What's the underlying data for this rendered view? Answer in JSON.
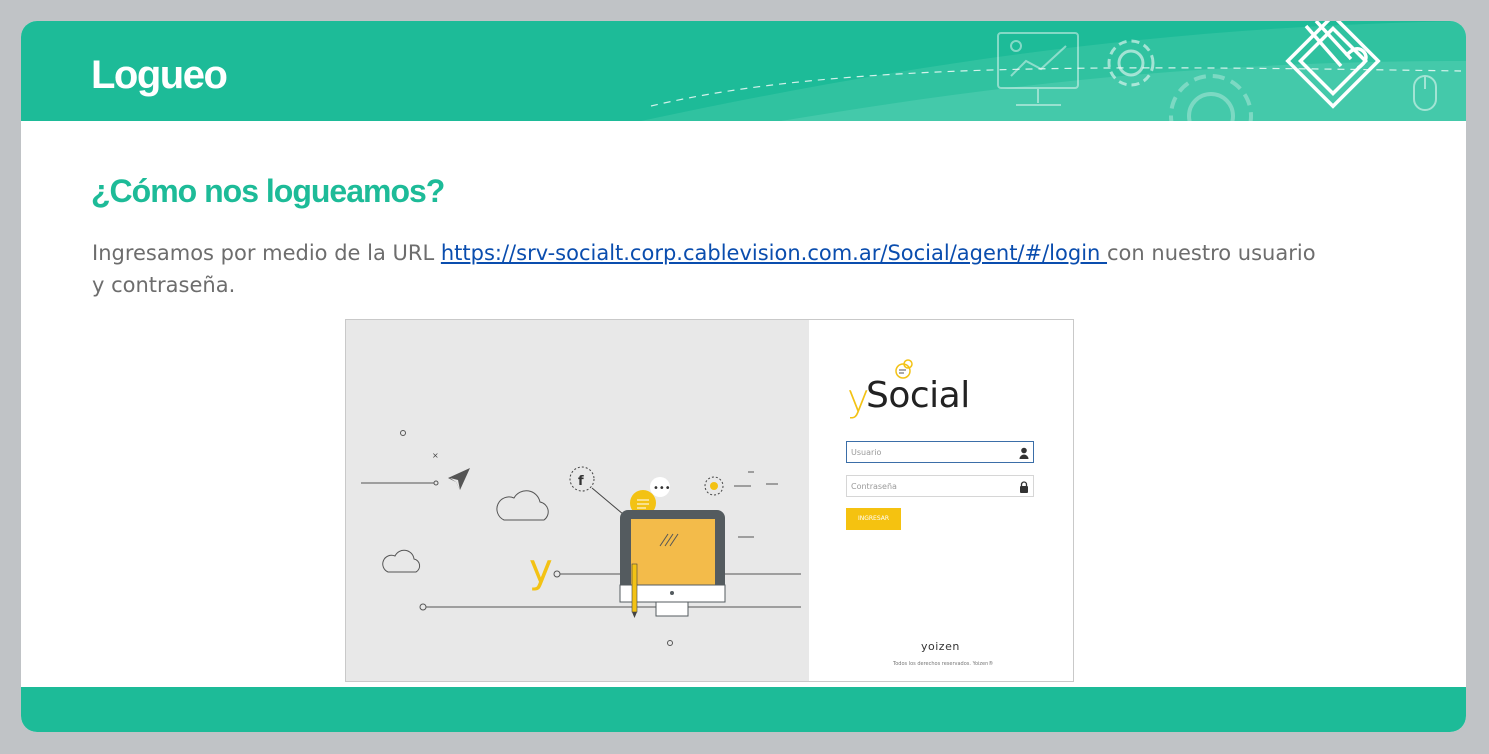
{
  "header": {
    "title": "Logueo"
  },
  "section": {
    "subtitle": "¿Cómo nos logueamos?",
    "text_before": "Ingresamos por medio de la URL ",
    "link": "https://srv-socialt.corp.cablevision.com.ar/Social/agent/#/login ",
    "text_after": "con nuestro usuario y contraseña."
  },
  "login_screenshot": {
    "logo_y": "y",
    "logo_text": "Social",
    "username_placeholder": "Usuario",
    "password_placeholder": "Contraseña",
    "login_button": "INGRESAR",
    "brand": "yoizen",
    "copyright": "Todos los derechos reservados. Yoizen®",
    "icons": [
      "user-icon",
      "lock-icon",
      "facebook-icon",
      "twitter-icon",
      "paper-plane-icon",
      "cloud-icon",
      "monitor-icon",
      "pencil-icon",
      "chat-bubble-icon"
    ]
  },
  "colors": {
    "brand_green": "#1dbb98",
    "link_blue": "#0a4dae",
    "body_text": "#6d6d6d",
    "accent_yellow": "#f5c210",
    "background_gray": "#c0c3c6"
  }
}
